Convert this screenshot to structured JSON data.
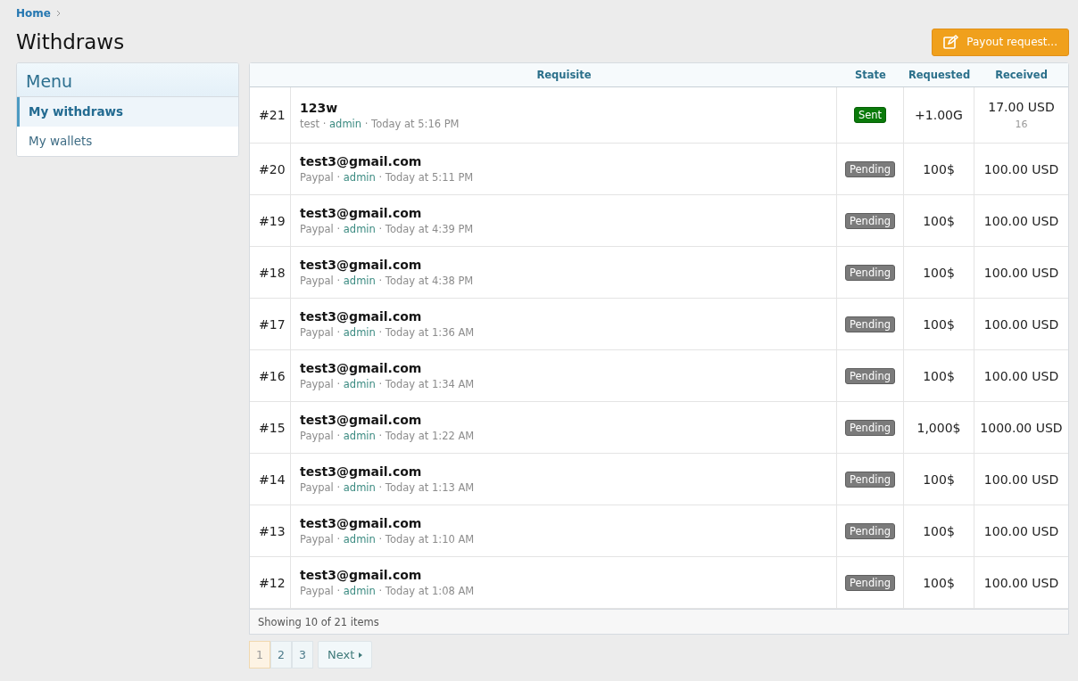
{
  "breadcrumb": [
    {
      "label": "Home"
    }
  ],
  "title": "Withdraws",
  "payout_button": "Payout request...",
  "menu": {
    "title": "Menu",
    "items": [
      {
        "label": "My withdraws",
        "selected": true
      },
      {
        "label": "My wallets",
        "selected": false
      }
    ]
  },
  "table": {
    "meta_separator": "·",
    "columns": [
      "Requisite",
      "State",
      "Requested",
      "Received"
    ],
    "rows": [
      {
        "number": "#21",
        "title": "123w",
        "method": "test",
        "user": "admin",
        "time": "Today at 5:16 PM",
        "state": {
          "kind": "sent",
          "label": "Sent"
        },
        "requested": "+1.00G",
        "received": "17.00 USD",
        "received_note": "16"
      },
      {
        "number": "#20",
        "title": "test3@gmail.com",
        "method": "Paypal",
        "user": "admin",
        "time": "Today at 5:11 PM",
        "state": {
          "kind": "pending",
          "label": "Pending"
        },
        "requested": "100$",
        "received": "100.00 USD"
      },
      {
        "number": "#19",
        "title": "test3@gmail.com",
        "method": "Paypal",
        "user": "admin",
        "time": "Today at 4:39 PM",
        "state": {
          "kind": "pending",
          "label": "Pending"
        },
        "requested": "100$",
        "received": "100.00 USD"
      },
      {
        "number": "#18",
        "title": "test3@gmail.com",
        "method": "Paypal",
        "user": "admin",
        "time": "Today at 4:38 PM",
        "state": {
          "kind": "pending",
          "label": "Pending"
        },
        "requested": "100$",
        "received": "100.00 USD"
      },
      {
        "number": "#17",
        "title": "test3@gmail.com",
        "method": "Paypal",
        "user": "admin",
        "time": "Today at 1:36 AM",
        "state": {
          "kind": "pending",
          "label": "Pending"
        },
        "requested": "100$",
        "received": "100.00 USD"
      },
      {
        "number": "#16",
        "title": "test3@gmail.com",
        "method": "Paypal",
        "user": "admin",
        "time": "Today at 1:34 AM",
        "state": {
          "kind": "pending",
          "label": "Pending"
        },
        "requested": "100$",
        "received": "100.00 USD"
      },
      {
        "number": "#15",
        "title": "test3@gmail.com",
        "method": "Paypal",
        "user": "admin",
        "time": "Today at 1:22 AM",
        "state": {
          "kind": "pending",
          "label": "Pending"
        },
        "requested": "1,000$",
        "received": "1000.00 USD"
      },
      {
        "number": "#14",
        "title": "test3@gmail.com",
        "method": "Paypal",
        "user": "admin",
        "time": "Today at 1:13 AM",
        "state": {
          "kind": "pending",
          "label": "Pending"
        },
        "requested": "100$",
        "received": "100.00 USD"
      },
      {
        "number": "#13",
        "title": "test3@gmail.com",
        "method": "Paypal",
        "user": "admin",
        "time": "Today at 1:10 AM",
        "state": {
          "kind": "pending",
          "label": "Pending"
        },
        "requested": "100$",
        "received": "100.00 USD"
      },
      {
        "number": "#12",
        "title": "test3@gmail.com",
        "method": "Paypal",
        "user": "admin",
        "time": "Today at 1:08 AM",
        "state": {
          "kind": "pending",
          "label": "Pending"
        },
        "requested": "100$",
        "received": "100.00 USD"
      }
    ],
    "footer": "Showing 10 of 21 items"
  },
  "pagination": {
    "pages": [
      {
        "label": "1",
        "selected": true
      },
      {
        "label": "2",
        "selected": false
      },
      {
        "label": "3",
        "selected": false
      }
    ],
    "next": "Next"
  }
}
